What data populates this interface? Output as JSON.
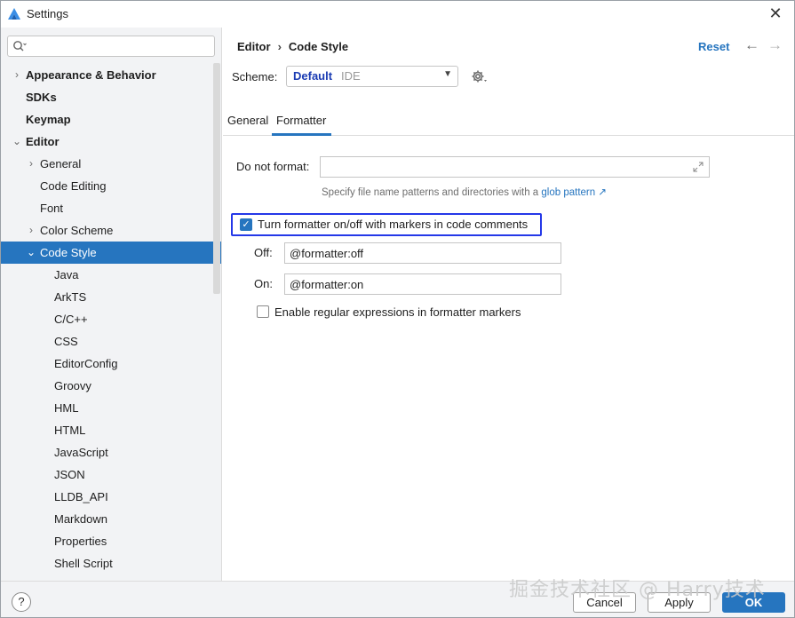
{
  "window": {
    "title": "Settings",
    "close_glyph": "✕"
  },
  "search": {
    "placeholder": "",
    "value": ""
  },
  "tree": [
    {
      "label": "Appearance & Behavior",
      "bold": true,
      "chevron": "›",
      "indent": 0,
      "selected": false
    },
    {
      "label": "SDKs",
      "bold": true,
      "chevron": "",
      "indent": 0,
      "selected": false
    },
    {
      "label": "Keymap",
      "bold": true,
      "chevron": "",
      "indent": 0,
      "selected": false
    },
    {
      "label": "Editor",
      "bold": true,
      "chevron": "⌄",
      "indent": 0,
      "selected": false
    },
    {
      "label": "General",
      "bold": false,
      "chevron": "›",
      "indent": 1,
      "selected": false
    },
    {
      "label": "Code Editing",
      "bold": false,
      "chevron": "",
      "indent": 1,
      "selected": false
    },
    {
      "label": "Font",
      "bold": false,
      "chevron": "",
      "indent": 1,
      "selected": false
    },
    {
      "label": "Color Scheme",
      "bold": false,
      "chevron": "›",
      "indent": 1,
      "selected": false
    },
    {
      "label": "Code Style",
      "bold": false,
      "chevron": "⌄",
      "indent": 1,
      "selected": true
    },
    {
      "label": "Java",
      "bold": false,
      "chevron": "",
      "indent": 2,
      "selected": false
    },
    {
      "label": "ArkTS",
      "bold": false,
      "chevron": "",
      "indent": 2,
      "selected": false
    },
    {
      "label": "C/C++",
      "bold": false,
      "chevron": "",
      "indent": 2,
      "selected": false
    },
    {
      "label": "CSS",
      "bold": false,
      "chevron": "",
      "indent": 2,
      "selected": false
    },
    {
      "label": "EditorConfig",
      "bold": false,
      "chevron": "",
      "indent": 2,
      "selected": false
    },
    {
      "label": "Groovy",
      "bold": false,
      "chevron": "",
      "indent": 2,
      "selected": false
    },
    {
      "label": "HML",
      "bold": false,
      "chevron": "",
      "indent": 2,
      "selected": false
    },
    {
      "label": "HTML",
      "bold": false,
      "chevron": "",
      "indent": 2,
      "selected": false
    },
    {
      "label": "JavaScript",
      "bold": false,
      "chevron": "",
      "indent": 2,
      "selected": false
    },
    {
      "label": "JSON",
      "bold": false,
      "chevron": "",
      "indent": 2,
      "selected": false
    },
    {
      "label": "LLDB_API",
      "bold": false,
      "chevron": "",
      "indent": 2,
      "selected": false
    },
    {
      "label": "Markdown",
      "bold": false,
      "chevron": "",
      "indent": 2,
      "selected": false
    },
    {
      "label": "Properties",
      "bold": false,
      "chevron": "",
      "indent": 2,
      "selected": false
    },
    {
      "label": "Shell Script",
      "bold": false,
      "chevron": "",
      "indent": 2,
      "selected": false
    }
  ],
  "header": {
    "breadcrumb": [
      "Editor",
      "Code Style"
    ],
    "breadcrumb_sep": "›",
    "reset_label": "Reset",
    "back_glyph": "←",
    "forward_glyph": "→"
  },
  "scheme": {
    "label": "Scheme:",
    "value": "Default",
    "sub": "IDE",
    "arrow": "▼"
  },
  "tabs": [
    {
      "label": "General",
      "active": false
    },
    {
      "label": "Formatter",
      "active": true
    }
  ],
  "formatter": {
    "do_not_format_label": "Do not format:",
    "do_not_format_value": "",
    "hint_prefix": "Specify file name patterns and directories with a",
    "hint_link": "glob pattern ↗",
    "marker_checkbox_label": "Turn formatter on/off with markers in code comments",
    "marker_checked": true,
    "check_glyph": "✓",
    "off_label": "Off:",
    "off_value": "@formatter:off",
    "on_label": "On:",
    "on_value": "@formatter:on",
    "regex_label": "Enable regular expressions in formatter markers",
    "regex_checked": false
  },
  "footer": {
    "help_label": "?",
    "cancel_label": "Cancel",
    "apply_label": "Apply",
    "ok_label": "OK"
  },
  "watermark": "掘金技术社区 @ Harry技术",
  "colors": {
    "accent": "#2675bf",
    "highlight_border": "#2438e8",
    "sidebar_bg": "#f2f3f5"
  }
}
